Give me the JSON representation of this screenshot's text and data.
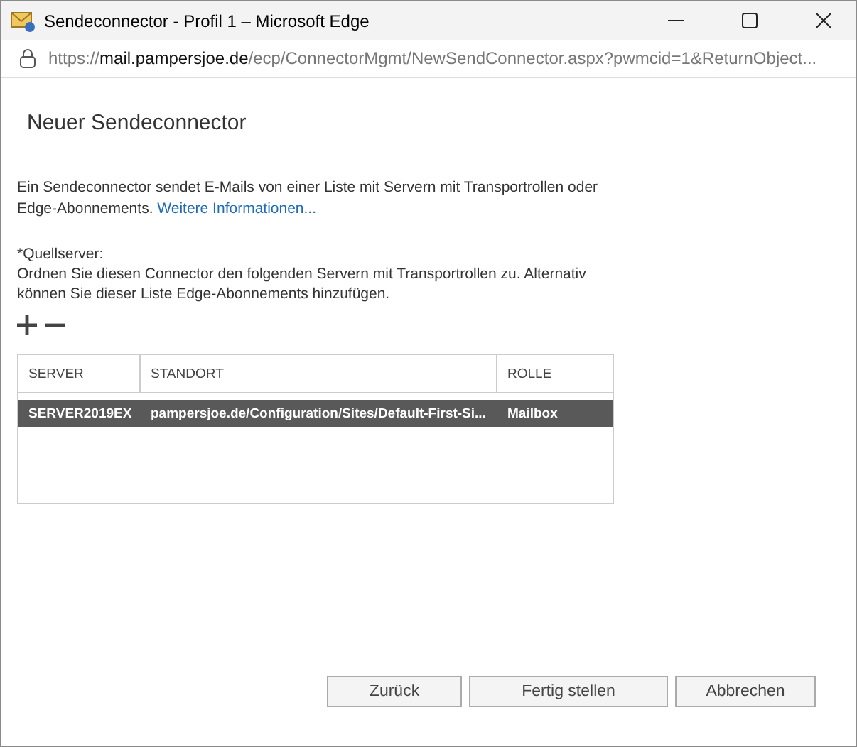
{
  "window": {
    "title": "Sendeconnector - Profil 1 – Microsoft Edge"
  },
  "address_bar": {
    "scheme": "https://",
    "host": "mail.pampersjoe.de",
    "path": "/ecp/ConnectorMgmt/NewSendConnector.aspx?pwmcid=1&ReturnObject..."
  },
  "page": {
    "heading": "Neuer Sendeconnector",
    "description": "Ein Sendeconnector sendet E-Mails von einer Liste mit Servern mit Transportrollen oder Edge-Abonnements.",
    "link": "Weitere Informationen...",
    "source_label": "*Quellserver:",
    "source_hint": "Ordnen Sie diesen Connector den folgenden Servern mit Transportrollen zu. Alternativ können Sie dieser Liste Edge-Abonnements hinzufügen.",
    "tools": [
      {
        "kind": "add"
      },
      {
        "kind": "remove"
      }
    ]
  },
  "table": {
    "columns": [
      "SERVER",
      "STANDORT",
      "ROLLE"
    ],
    "rows": [
      {
        "cells": [
          "SERVER2019EX",
          "pampersjoe.de/Configuration/Sites/Default-First-Si...",
          "Mailbox"
        ],
        "selected": true
      }
    ]
  },
  "buttons": [
    "Zurück",
    "Fertig stellen",
    "Abbrechen"
  ]
}
